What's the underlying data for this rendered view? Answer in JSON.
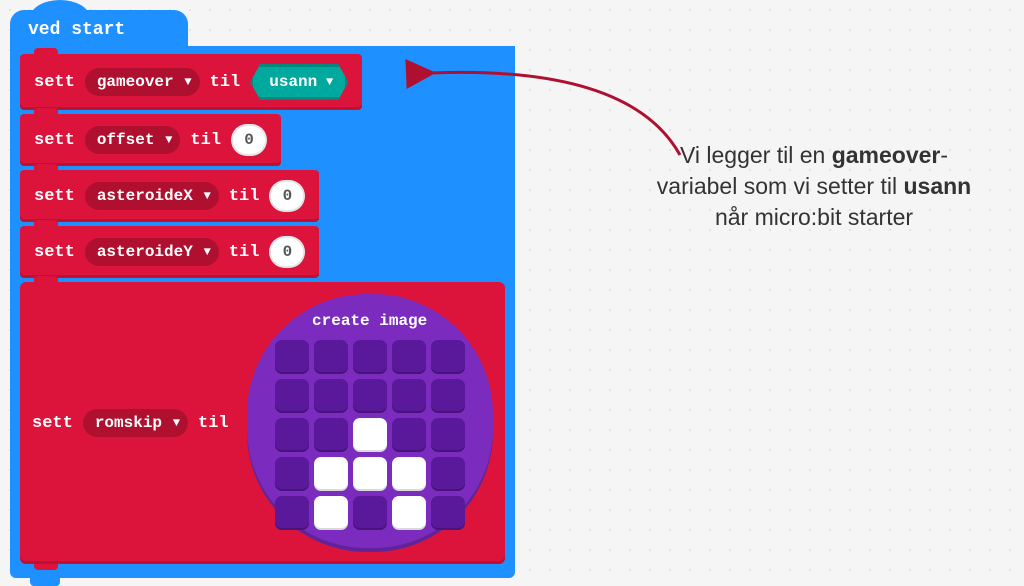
{
  "hat": {
    "label": "ved start"
  },
  "blocks": {
    "set_word": "sett",
    "til_word": "til",
    "items": [
      {
        "var": "gameover",
        "value_type": "bool",
        "value": "usann"
      },
      {
        "var": "offset",
        "value_type": "num",
        "value": "0"
      },
      {
        "var": "asteroideX",
        "value_type": "num",
        "value": "0"
      },
      {
        "var": "asteroideY",
        "value_type": "num",
        "value": "0"
      },
      {
        "var": "romskip",
        "value_type": "image"
      }
    ]
  },
  "create_image": {
    "label": "create image",
    "grid": [
      [
        0,
        0,
        0,
        0,
        0
      ],
      [
        0,
        0,
        0,
        0,
        0
      ],
      [
        0,
        0,
        1,
        0,
        0
      ],
      [
        0,
        1,
        1,
        1,
        0
      ],
      [
        0,
        1,
        0,
        1,
        0
      ]
    ]
  },
  "annotation": {
    "t1": "Vi legger til en ",
    "b1": "gameover",
    "t2": "-variabel som vi setter til ",
    "b2": "usann",
    "t3": " når micro:bit starter"
  }
}
